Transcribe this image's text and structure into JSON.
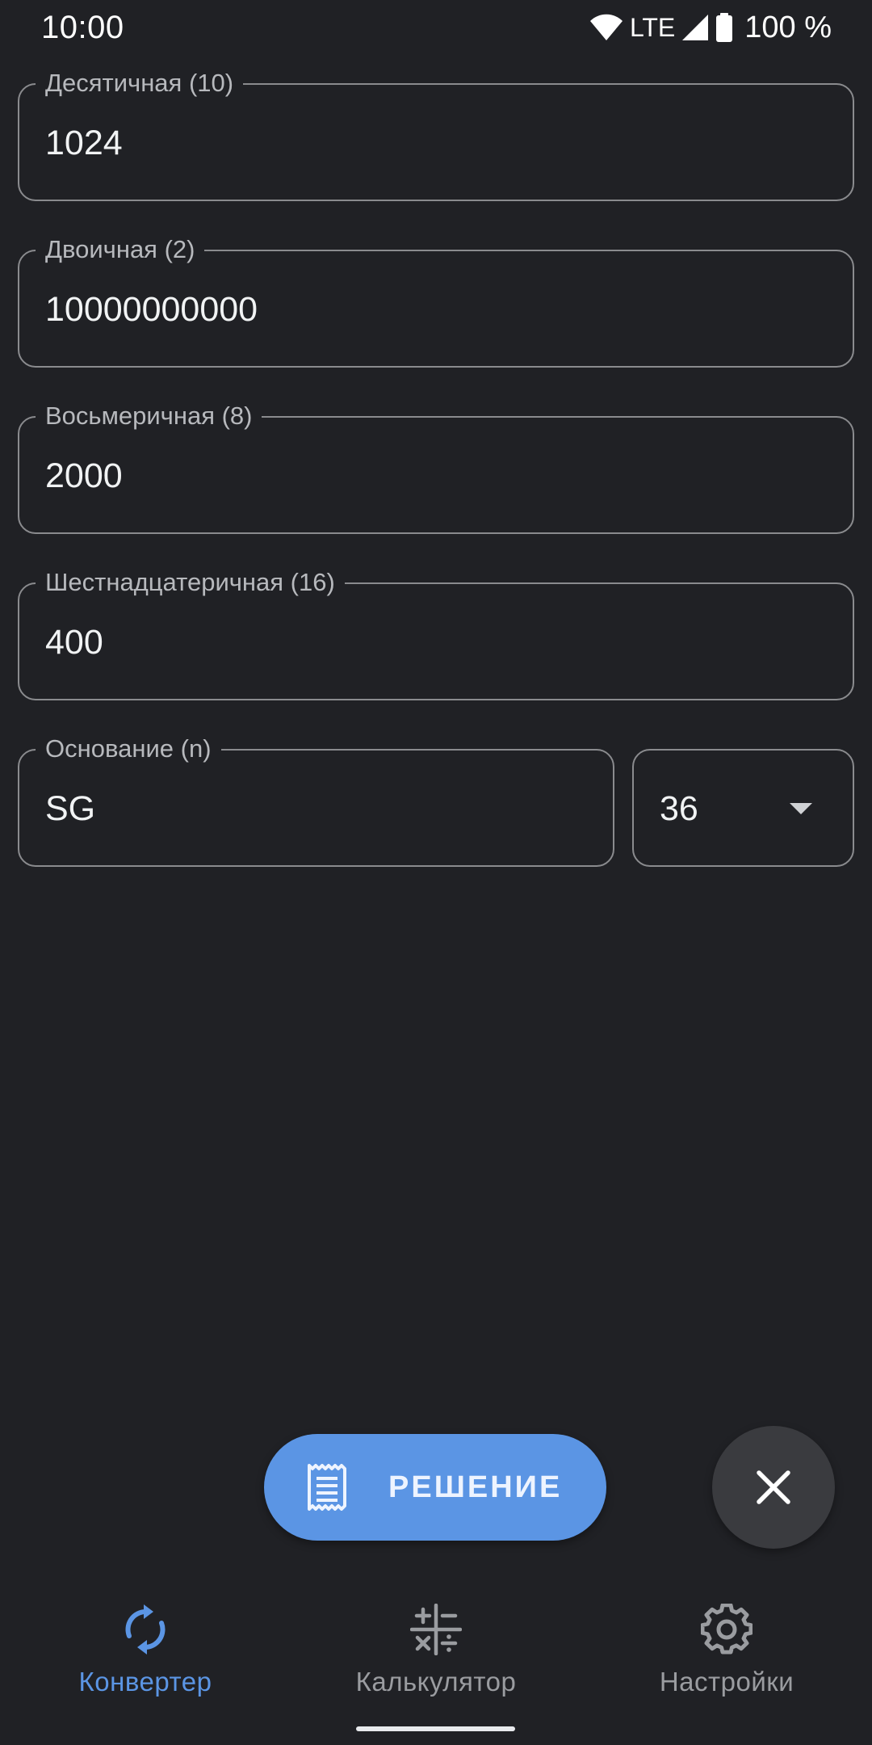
{
  "status_bar": {
    "time": "10:00",
    "network": "LTE",
    "battery": "100 %"
  },
  "fields": {
    "decimal": {
      "label": "Десятичная (10)",
      "value": "1024"
    },
    "binary": {
      "label": "Двоичная (2)",
      "value": "10000000000"
    },
    "octal": {
      "label": "Восьмеричная (8)",
      "value": "2000"
    },
    "hex": {
      "label": "Шестнадцатеричная (16)",
      "value": "400"
    },
    "custom": {
      "label": "Основание (n)",
      "value": "SG"
    }
  },
  "base_select": {
    "value": "36"
  },
  "actions": {
    "solution_label": "РЕШЕНИЕ",
    "close_icon": "close-icon"
  },
  "nav": {
    "items": [
      {
        "label": "Конвертер",
        "icon": "sync-icon",
        "active": true
      },
      {
        "label": "Калькулятор",
        "icon": "calculator-icon",
        "active": false
      },
      {
        "label": "Настройки",
        "icon": "settings-icon",
        "active": false
      }
    ]
  },
  "colors": {
    "background": "#202125",
    "accent": "#5b95e4",
    "outline": "#8a8b8e"
  }
}
